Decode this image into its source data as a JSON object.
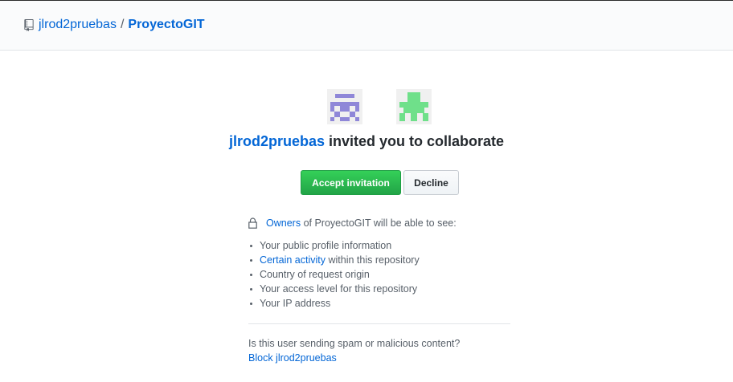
{
  "header": {
    "icon": "repo-icon",
    "owner": "jlrod2pruebas",
    "separator": "/",
    "repo": "ProyectoGIT"
  },
  "avatars": [
    {
      "name": "inviter-avatar",
      "color": "#8f87d8"
    },
    {
      "name": "invitee-avatar",
      "color": "#6fe08a"
    }
  ],
  "invitation": {
    "inviter": "jlrod2pruebas",
    "message": "invited you to collaborate"
  },
  "buttons": {
    "accept_label": "Accept invitation",
    "decline_label": "Decline"
  },
  "visibility": {
    "icon": "lock-icon",
    "owners_link": "Owners",
    "sentence_rest": "of ProyectoGIT will be able to see:"
  },
  "permissions": [
    {
      "text": "Your public profile information"
    },
    {
      "link": "Certain activity",
      "text": "within this repository"
    },
    {
      "text": "Country of request origin"
    },
    {
      "text": "Your access level for this repository"
    },
    {
      "text": "Your IP address"
    }
  ],
  "footer": {
    "question": "Is this user sending spam or malicious content?",
    "block_link": "Block jlrod2pruebas"
  },
  "colors": {
    "link": "#0366d6",
    "accept_green": "#28a745",
    "text": "#24292e",
    "muted": "#586069"
  }
}
